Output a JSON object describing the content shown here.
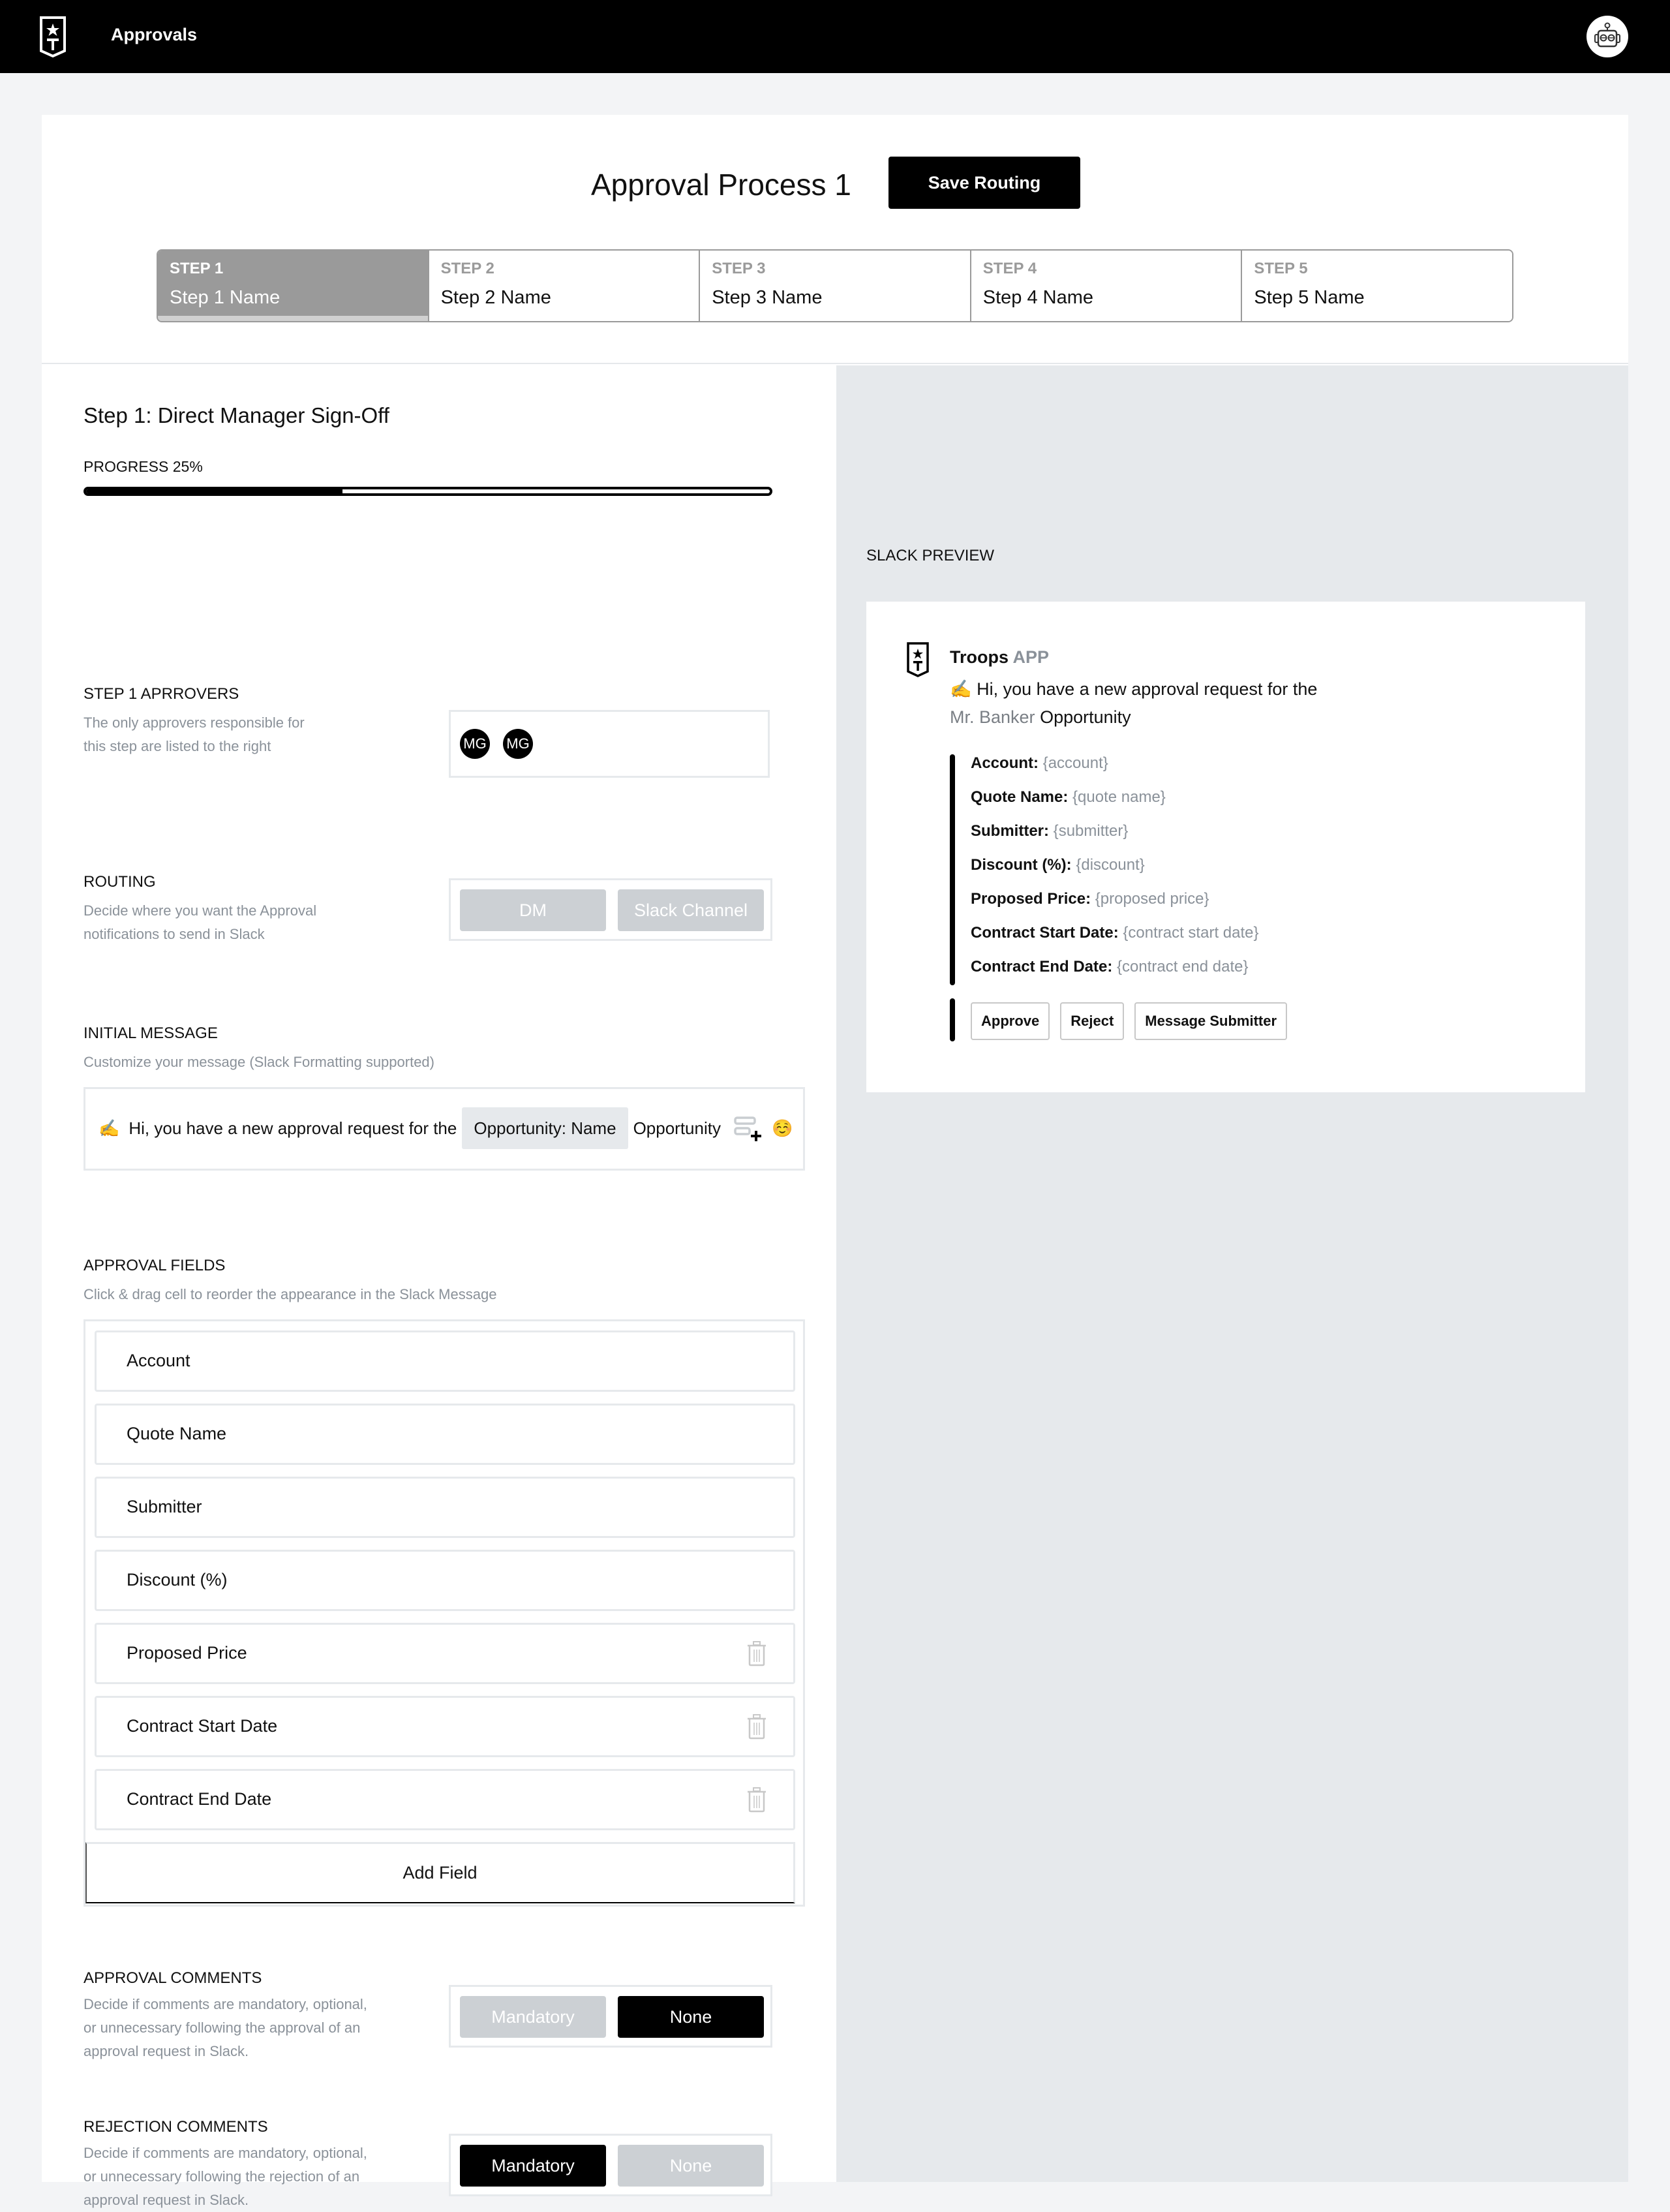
{
  "topbar": {
    "app_title": "Approvals",
    "logo_icon": "troops-shield-logo",
    "avatar_icon": "robot-avatar"
  },
  "header": {
    "process_title": "Approval Process 1",
    "save_button": "Save Routing"
  },
  "steps": [
    {
      "num": "STEP 1",
      "name": "Step 1 Name",
      "active": true
    },
    {
      "num": "STEP 2",
      "name": "Step 2 Name",
      "active": false
    },
    {
      "num": "STEP 3",
      "name": "Step 3 Name",
      "active": false
    },
    {
      "num": "STEP 4",
      "name": "Step 4 Name",
      "active": false
    },
    {
      "num": "STEP 5",
      "name": "Step 5 Name",
      "active": false
    }
  ],
  "step_detail": {
    "heading": "Step 1: Direct Manager Sign-Off",
    "progress_label": "PROGRESS 25%",
    "progress_percent": 25
  },
  "approvers": {
    "title": "STEP 1 APRROVERS",
    "desc_line1": "The only approvers responsible for",
    "desc_line2": "this step are listed to the right",
    "avatars": [
      "MG",
      "MG"
    ]
  },
  "routing": {
    "title": "ROUTING",
    "desc_line1": "Decide where you want the Approval",
    "desc_line2": "notifications to send in Slack",
    "options": [
      "DM",
      "Slack Channel"
    ]
  },
  "initial_message": {
    "title": "INITIAL MESSAGE",
    "desc": "Customize your message (Slack Formatting supported)",
    "emoji_lead": "✍️",
    "text_before": "Hi, you have a new approval request for the",
    "chip": "Opportunity: Name",
    "text_after": "Opportunity",
    "insert_field_icon": "insert-field-icon",
    "emoji_icon": "☺️"
  },
  "approval_fields": {
    "title": "APPROVAL FIELDS",
    "desc": "Click & drag cell to reorder the appearance in the Slack Message",
    "fields": [
      {
        "label": "Account",
        "deletable": false
      },
      {
        "label": "Quote Name",
        "deletable": false
      },
      {
        "label": "Submitter",
        "deletable": false
      },
      {
        "label": "Discount (%)",
        "deletable": false
      },
      {
        "label": "Proposed Price",
        "deletable": true
      },
      {
        "label": "Contract Start Date",
        "deletable": true
      },
      {
        "label": "Contract End Date",
        "deletable": true
      }
    ],
    "add_button": "Add Field"
  },
  "approval_comments": {
    "title": "APPROVAL COMMENTS",
    "desc_line1": "Decide if comments are mandatory, optional,",
    "desc_line2": "or unnecessary following the approval of an",
    "desc_line3": "approval request in Slack.",
    "options": [
      "Mandatory",
      "None"
    ],
    "selected": "None"
  },
  "rejection_comments": {
    "title": "REJECTION COMMENTS",
    "desc_line1": "Decide if comments are mandatory, optional,",
    "desc_line2": "or unnecessary following the rejection of an",
    "desc_line3": "approval request in Slack.",
    "options": [
      "Mandatory",
      "None"
    ],
    "selected": "Mandatory"
  },
  "slack_preview": {
    "label": "SLACK PREVIEW",
    "app_name": "Troops",
    "app_tag": "APP",
    "line1": "✍️ Hi, you have a new approval request for the",
    "line2_muted": "Mr. Banker",
    "line2_rest": "Opportunity",
    "fields": [
      {
        "key": "Account:",
        "value": "{account}"
      },
      {
        "key": "Quote Name:",
        "value": "{quote name}"
      },
      {
        "key": "Submitter:",
        "value": "{submitter}"
      },
      {
        "key": "Discount (%):",
        "value": "{discount}"
      },
      {
        "key": "Proposed Price:",
        "value": "{proposed price}"
      },
      {
        "key": "Contract Start Date:",
        "value": "{contract start date}"
      },
      {
        "key": "Contract End Date:",
        "value": "{contract end date}"
      }
    ],
    "actions": [
      "Approve",
      "Reject",
      "Message Submitter"
    ]
  }
}
